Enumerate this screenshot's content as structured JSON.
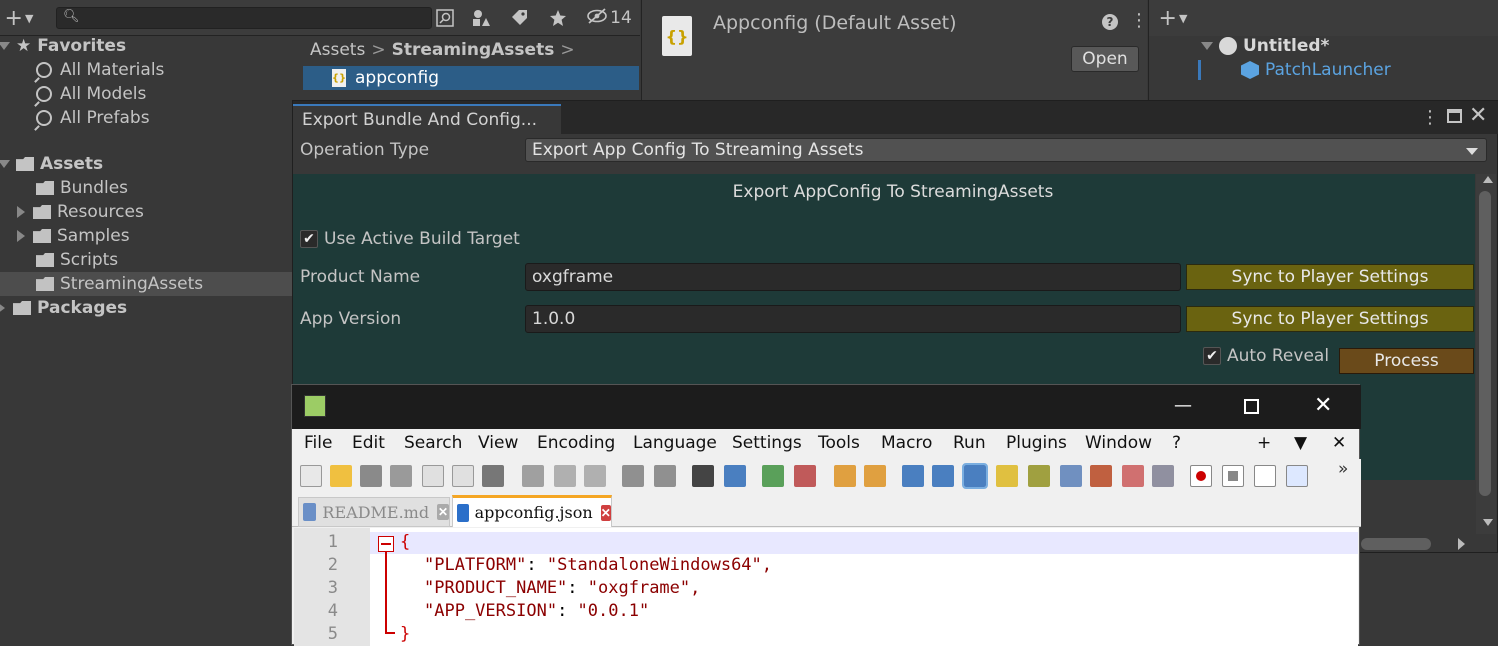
{
  "project": {
    "hidden_count": "14",
    "breadcrumb": [
      "Assets",
      "StreamingAssets"
    ],
    "selected_file": "appconfig",
    "tree": [
      {
        "label": "Favorites",
        "type": "favorites"
      },
      {
        "label": "All Materials",
        "type": "search"
      },
      {
        "label": "All Models",
        "type": "search"
      },
      {
        "label": "All Prefabs",
        "type": "search"
      },
      {
        "label": "Assets",
        "type": "root"
      },
      {
        "label": "Bundles",
        "type": "folder"
      },
      {
        "label": "Resources",
        "type": "folder"
      },
      {
        "label": "Samples",
        "type": "folder"
      },
      {
        "label": "Scripts",
        "type": "folder"
      },
      {
        "label": "StreamingAssets",
        "type": "folder"
      },
      {
        "label": "Packages",
        "type": "root"
      }
    ]
  },
  "inspector": {
    "title": "Appconfig (Default Asset)",
    "open_label": "Open",
    "icon_glyph": "{}"
  },
  "hierarchy": {
    "scene": "Untitled*",
    "object": "PatchLauncher"
  },
  "export_window": {
    "tab_title": "Export Bundle And Config...",
    "operation_label": "Operation Type",
    "operation_value": "Export App Config To Streaming Assets",
    "section_title": "Export AppConfig To StreamingAssets",
    "use_active_build_target": "Use Active Build Target",
    "product_name_label": "Product Name",
    "product_name_value": "oxgframe",
    "app_version_label": "App Version",
    "app_version_value": "1.0.0",
    "sync_label": "Sync to Player Settings",
    "auto_reveal": "Auto Reveal",
    "process": "Process",
    "green_bg": "#1e3a38"
  },
  "notepad": {
    "menu": [
      "File",
      "Edit",
      "Search",
      "View",
      "Encoding",
      "Language",
      "Settings",
      "Tools",
      "Macro",
      "Run",
      "Plugins",
      "Window",
      "?"
    ],
    "menu_right": [
      "+",
      "▼",
      "✕"
    ],
    "tabs": [
      {
        "label": "README.md",
        "active": false
      },
      {
        "label": "appconfig.json",
        "active": true
      }
    ],
    "lines": [
      {
        "n": "1",
        "text": "{"
      },
      {
        "n": "2",
        "key": "\"PLATFORM\"",
        "value": "\"StandaloneWindows64\","
      },
      {
        "n": "3",
        "key": "\"PRODUCT_NAME\"",
        "value": "\"oxgframe\","
      },
      {
        "n": "4",
        "key": "\"APP_VERSION\"",
        "value": "\"0.0.1\""
      },
      {
        "n": "5",
        "text": "}"
      }
    ]
  }
}
